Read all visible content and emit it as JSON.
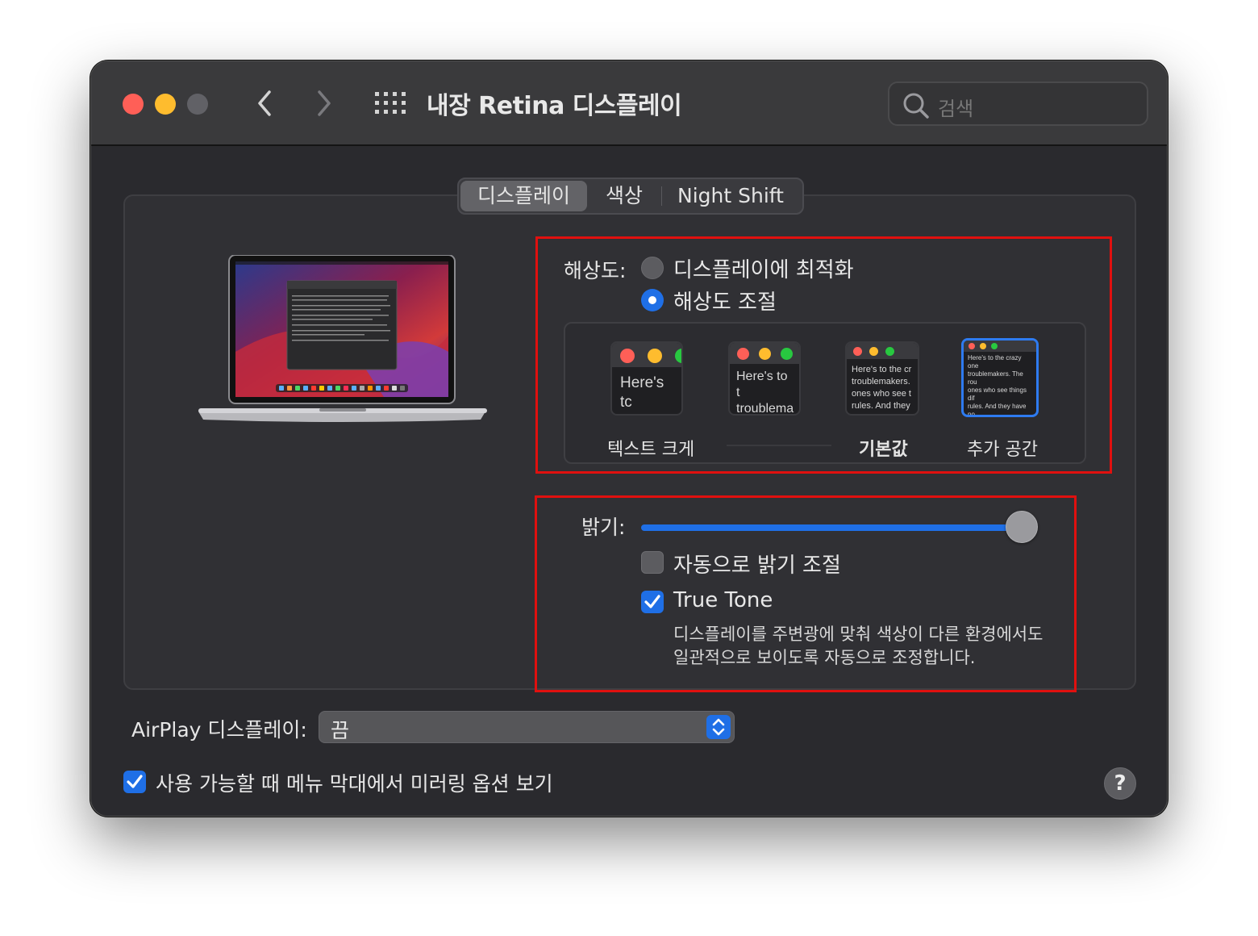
{
  "window": {
    "title": "내장 Retina 디스플레이",
    "search_placeholder": "검색"
  },
  "tabs": [
    {
      "label": "디스플레이",
      "active": true
    },
    {
      "label": "색상",
      "active": false
    },
    {
      "label": "Night Shift",
      "active": false
    }
  ],
  "resolution": {
    "label": "해상도:",
    "option_optimized": "디스플레이에 최적화",
    "option_scaled": "해상도 조절",
    "selected": "option_scaled",
    "scales": [
      {
        "preview_text": "Here's tc\ntroublem"
      },
      {
        "preview_text": "Here's to t\ntroublema\nones who"
      },
      {
        "preview_text": "Here's to the cr\ntroublemakers.\nones who see t\nrules. And they"
      },
      {
        "preview_text": "Here's to the crazy one\ntroublemakers. The rou\nones who see things dif\nrules. And they have no\ncan quote them, disagr\nthem. About the only th\nBecause they change t"
      }
    ],
    "selected_scale": 3,
    "scale_labels": {
      "larger_text": "텍스트 크게",
      "default": "기본값",
      "more_space": "추가 공간"
    }
  },
  "brightness": {
    "label": "밝기:",
    "level": 1.0,
    "auto_label": "자동으로 밝기 조절",
    "auto_checked": false,
    "true_tone_label": "True Tone",
    "true_tone_checked": true,
    "true_tone_desc_line1": "디스플레이를 주변광에 맞춰 색상이 다른 환경에서도",
    "true_tone_desc_line2": "일관적으로 보이도록 자동으로 조정합니다."
  },
  "airplay": {
    "label": "AirPlay 디스플레이:",
    "value": "끔"
  },
  "mirroring": {
    "label": "사용 가능할 때 메뉴 막대에서 미러링 옵션 보기",
    "checked": true
  },
  "colors": {
    "accent": "#1f6fe6",
    "close": "#ff5f57",
    "minimize": "#febc2e",
    "highlight_box": "#e0100f"
  }
}
